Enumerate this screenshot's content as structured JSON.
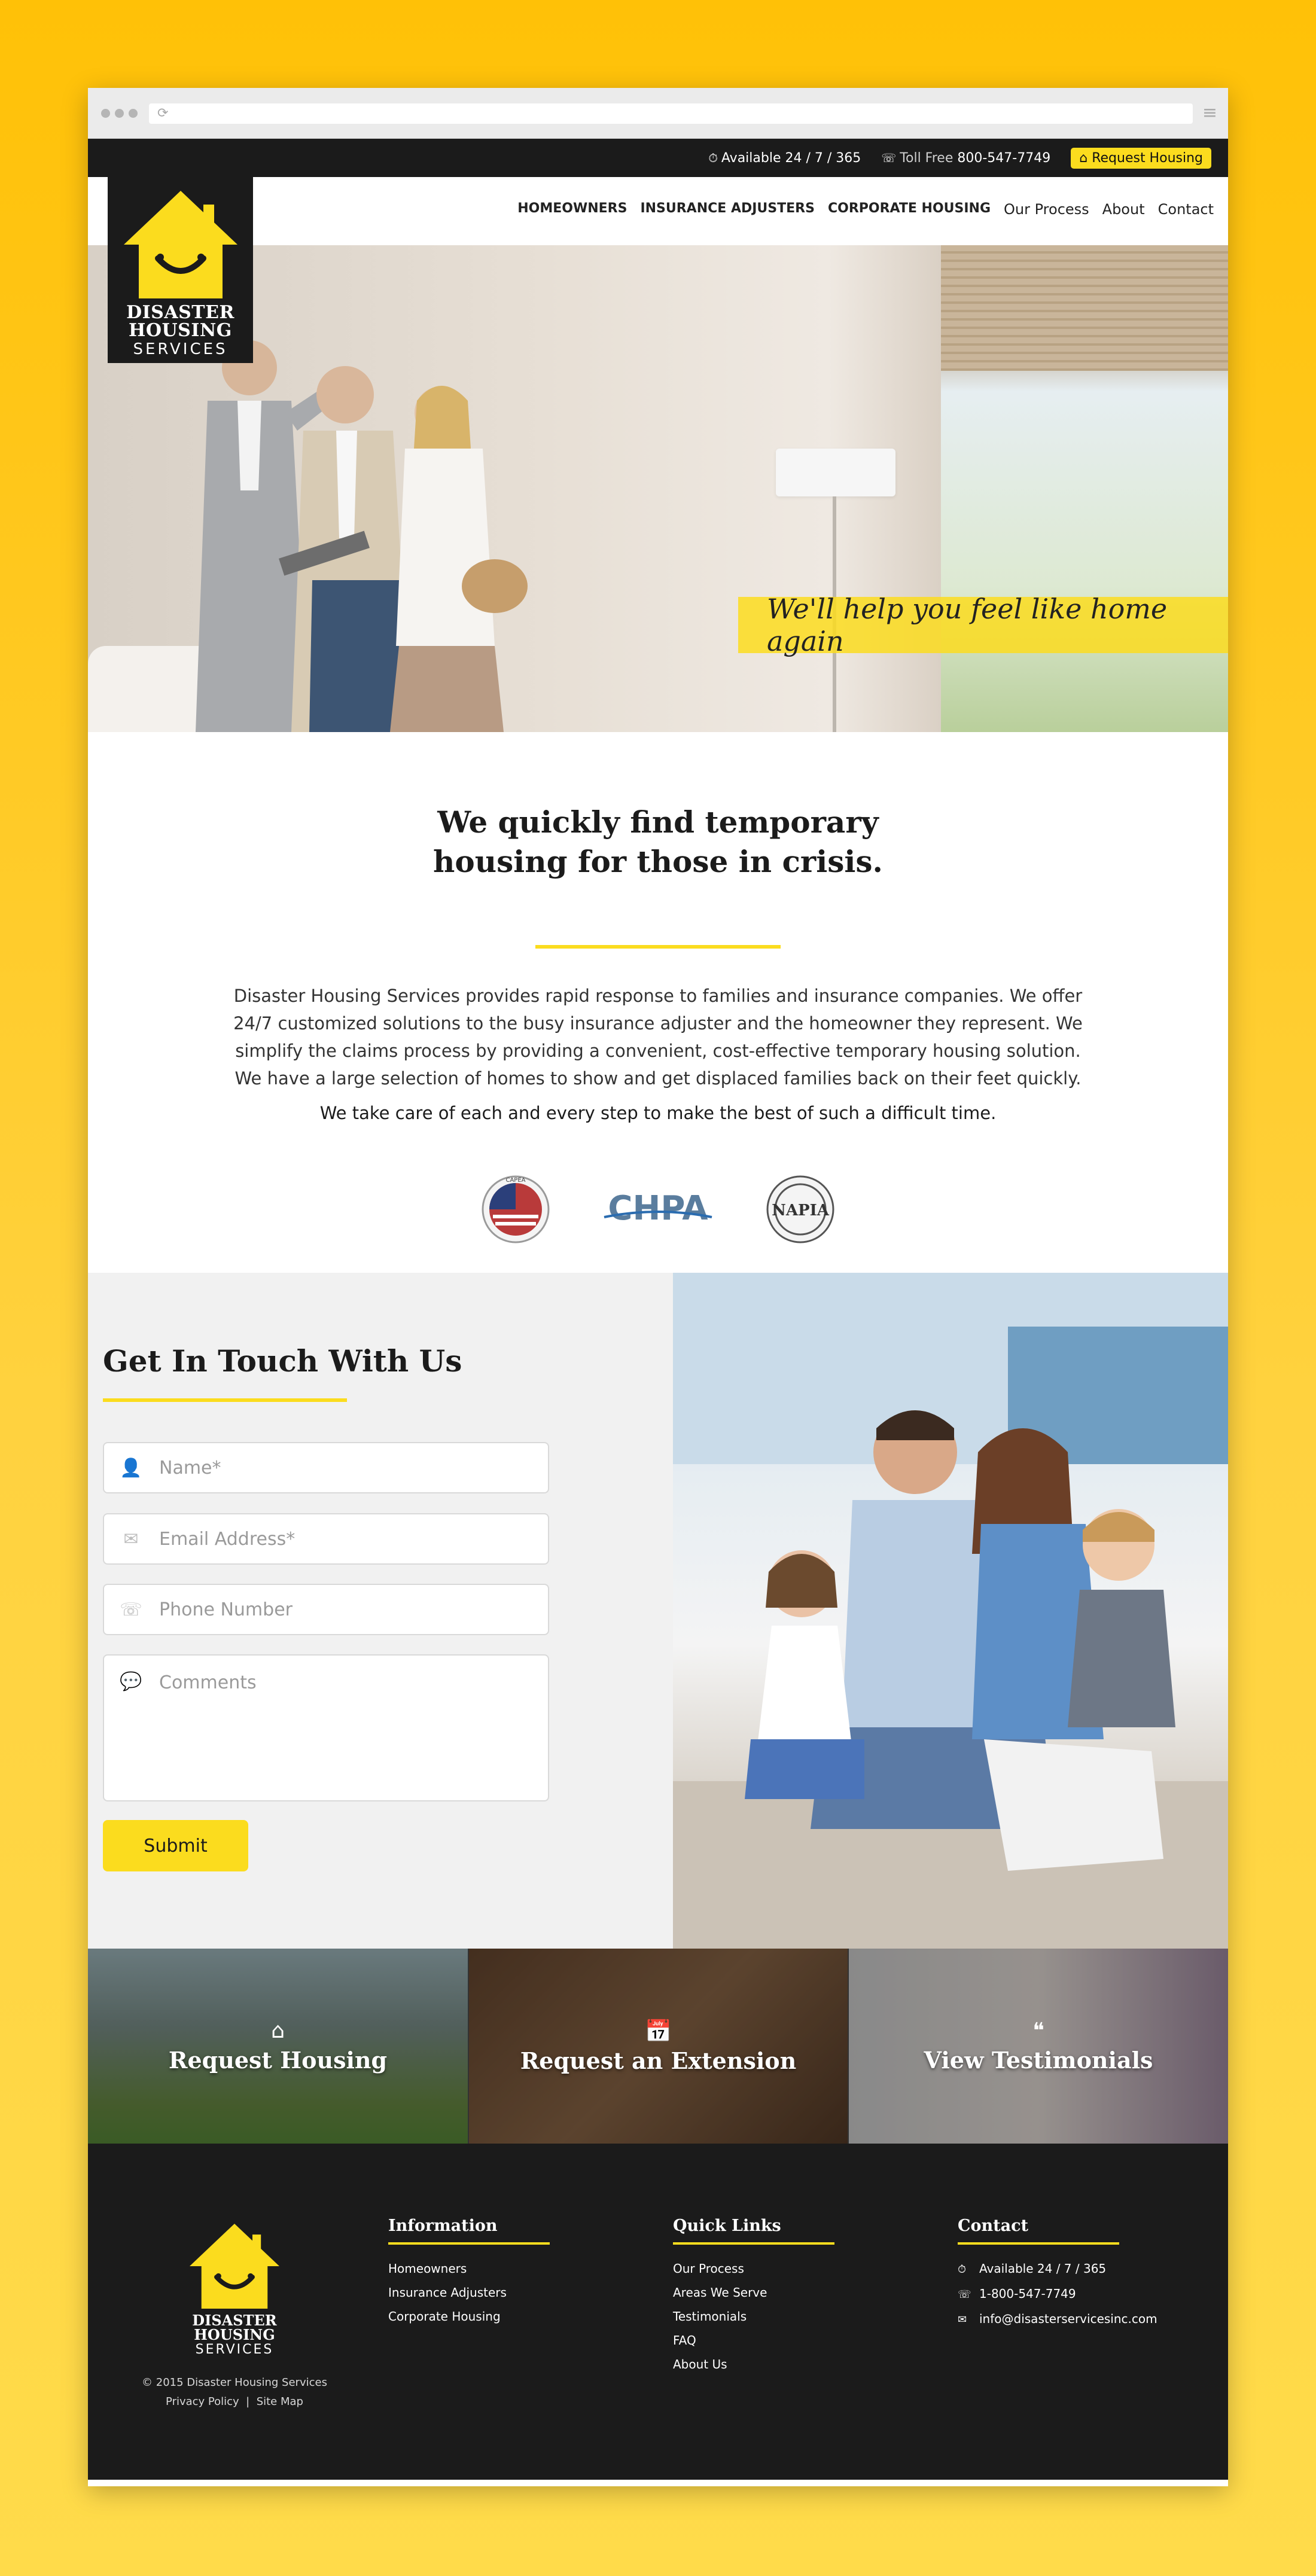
{
  "topbar": {
    "availability": "Available 24 / 7 / 365",
    "toll_free_label": "Toll Free",
    "toll_free_number": "800-547-7749",
    "request_button": "Request Housing"
  },
  "nav": {
    "items": [
      {
        "label": "HOMEOWNERS"
      },
      {
        "label": "INSURANCE ADJUSTERS"
      },
      {
        "label": "CORPORATE HOUSING"
      },
      {
        "label": "Our Process"
      },
      {
        "label": "About"
      },
      {
        "label": "Contact"
      }
    ]
  },
  "logo": {
    "line1": "DISASTER",
    "line2": "HOUSING",
    "line3": "SERVICES"
  },
  "hero": {
    "banner_text": "We'll help you feel like home again"
  },
  "intro": {
    "heading_line1": "We quickly find temporary",
    "heading_line2": "housing for those in crisis.",
    "description": "Disaster Housing Services provides rapid response to families and insurance companies. We offer 24/7 customized solutions to the busy insurance adjuster and the homeowner they represent. We simplify the claims process by providing a convenient, cost-effective temporary housing solution. We have a large selection of homes to show and get displaced families back on their feet quickly.",
    "tagline": "We take care of each and every step to make the best of such a difficult time.",
    "badges": [
      {
        "label": "CAPEA"
      },
      {
        "label": "CHPA"
      },
      {
        "label": "NAPIA"
      }
    ]
  },
  "contact": {
    "heading": "Get In Touch With Us",
    "name_placeholder": "Name*",
    "email_placeholder": "Email Address*",
    "phone_placeholder": "Phone Number",
    "comments_placeholder": "Comments",
    "submit_label": "Submit"
  },
  "tiles": [
    {
      "label": "Request Housing"
    },
    {
      "label": "Request an Extension"
    },
    {
      "label": "View Testimonials"
    }
  ],
  "footer": {
    "copyright": "© 2015 Disaster Housing Services",
    "privacy": "Privacy Policy",
    "separator": "|",
    "sitemap": "Site Map",
    "information": {
      "heading": "Information",
      "links": [
        "Homeowners",
        "Insurance Adjusters",
        "Corporate Housing"
      ]
    },
    "quick_links": {
      "heading": "Quick Links",
      "links": [
        "Our Process",
        "Areas We Serve",
        "Testimonials",
        "FAQ",
        "About Us"
      ]
    },
    "contact": {
      "heading": "Contact",
      "availability": "Available 24 / 7 / 365",
      "phone": "1-800-547-7749",
      "email": "info@disasterservicesinc.com"
    }
  },
  "colors": {
    "accent": "#fbdc1e",
    "dark": "#1b1b1b"
  }
}
